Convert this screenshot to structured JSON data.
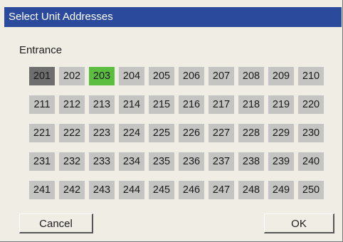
{
  "dialog": {
    "title": "Select Unit Addresses",
    "group_label": "Entrance",
    "units": [
      "201",
      "202",
      "203",
      "204",
      "205",
      "206",
      "207",
      "208",
      "209",
      "210",
      "211",
      "212",
      "213",
      "214",
      "215",
      "216",
      "217",
      "218",
      "219",
      "220",
      "221",
      "222",
      "223",
      "224",
      "225",
      "226",
      "227",
      "228",
      "229",
      "230",
      "231",
      "232",
      "233",
      "234",
      "235",
      "236",
      "237",
      "238",
      "239",
      "240",
      "241",
      "242",
      "243",
      "244",
      "245",
      "246",
      "247",
      "248",
      "249",
      "250"
    ],
    "current_unit": "201",
    "selected_unit": "203",
    "cancel_label": "Cancel",
    "ok_label": "OK"
  },
  "colors": {
    "titlebar": "#2b4a9c",
    "unit": "#c4c4c2",
    "current": "#6e6e6e",
    "selected": "#5cbe40"
  }
}
